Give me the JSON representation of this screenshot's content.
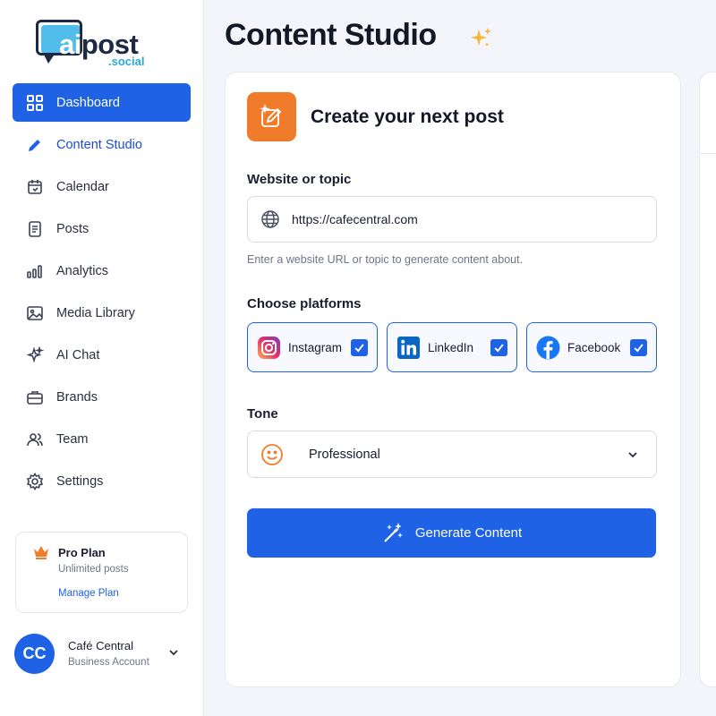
{
  "brand": {
    "logo_word": "aipost",
    "logo_ai": "ai",
    "logo_rest": "post",
    "logo_sub": ".social"
  },
  "sidebar": {
    "items": [
      {
        "label": "Dashboard",
        "icon": "grid-icon",
        "state": "active"
      },
      {
        "label": "Content Studio",
        "icon": "pencil-icon",
        "state": "current"
      },
      {
        "label": "Calendar",
        "icon": "calendar-icon",
        "state": ""
      },
      {
        "label": "Posts",
        "icon": "document-icon",
        "state": ""
      },
      {
        "label": "Analytics",
        "icon": "bar-chart-icon",
        "state": ""
      },
      {
        "label": "Media Library",
        "icon": "image-icon",
        "state": ""
      },
      {
        "label": "AI Chat",
        "icon": "sparkle-icon",
        "state": ""
      },
      {
        "label": "Brands",
        "icon": "briefcase-icon",
        "state": ""
      },
      {
        "label": "Team",
        "icon": "team-icon",
        "state": ""
      },
      {
        "label": "Settings",
        "icon": "gear-icon",
        "state": ""
      }
    ],
    "plan": {
      "title": "Pro Plan",
      "desc": "Unlimited posts",
      "link": "Manage Plan"
    },
    "account": {
      "initials": "CC",
      "name": "Café Central",
      "type": "Business Account"
    }
  },
  "main": {
    "title": "Content Studio",
    "card": {
      "title": "Create your next post",
      "website_label": "Website or topic",
      "website_value": "https://cafecentral.com",
      "website_hint": "Enter a website URL or topic to generate content about.",
      "platforms_label": "Choose platforms",
      "platforms": [
        {
          "label": "Instagram",
          "icon": "instagram-icon",
          "checked": true
        },
        {
          "label": "LinkedIn",
          "icon": "linkedin-icon",
          "checked": true
        },
        {
          "label": "Facebook",
          "icon": "facebook-icon",
          "checked": true
        }
      ],
      "tone_label": "Tone",
      "tone_value": "Professional",
      "generate_label": "Generate Content"
    }
  },
  "colors": {
    "accent": "#1f62e6",
    "orange": "#f07b2a"
  }
}
